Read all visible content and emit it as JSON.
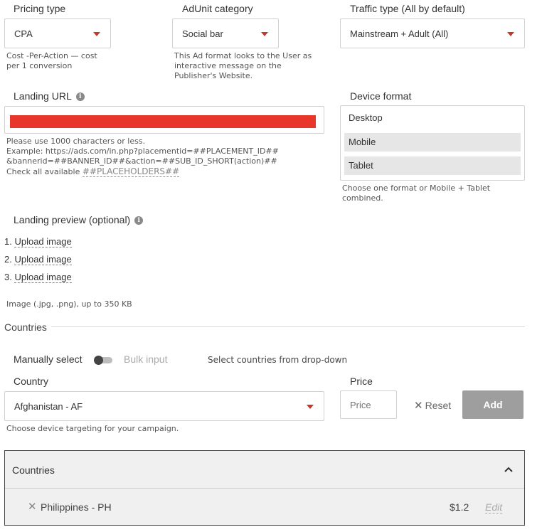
{
  "pricing": {
    "label": "Pricing type",
    "value": "CPA",
    "hint": "Cost -Per-Action — cost per 1 conversion"
  },
  "adunit": {
    "label": "AdUnit category",
    "value": "Social bar",
    "hint": "This Ad format looks to the User as interactive message on the Publisher's Website."
  },
  "traffic": {
    "label": "Traffic type (All by default)",
    "value": "Mainstream + Adult (All)"
  },
  "landing": {
    "label": "Landing URL",
    "hint_line1": "Please use 1000 characters or less.",
    "hint_line2": "Example: https://ads.com/in.php?placementid=##PLACEMENT_ID##",
    "hint_line3": "&bannerid=##BANNER_ID##&action=##SUB_ID_SHORT(action)##",
    "hint_line4_prefix": "Check all available ",
    "hint_line4_link": "##PLACEHOLDERS##"
  },
  "device": {
    "label": "Device format",
    "options": [
      "Desktop",
      "Mobile",
      "Tablet"
    ],
    "hint": "Choose one format or Mobile + Tablet combined."
  },
  "preview": {
    "label": "Landing preview (optional)",
    "items": [
      {
        "num": "1.",
        "label": "Upload image"
      },
      {
        "num": "2.",
        "label": "Upload image"
      },
      {
        "num": "3.",
        "label": "Upload image"
      }
    ],
    "hint": "Image (.jpg, .png), up to 350 KB"
  },
  "countries_section": {
    "title": "Countries",
    "manual_label": "Manually select",
    "bulk_label": "Bulk input",
    "select_hint": "Select countries from drop-down",
    "country_label": "Country",
    "country_value": "Afghanistan - AF",
    "price_label": "Price",
    "price_placeholder": "Price",
    "reset_label": "Reset",
    "add_label": "Add",
    "device_hint": "Choose device targeting for your campaign."
  },
  "countries_table": {
    "header": "Countries",
    "rows": [
      {
        "name": "Philippines - PH",
        "price": "$1.2",
        "edit": "Edit"
      }
    ]
  },
  "colors": {
    "accent": "#c0392b",
    "redacted": "#e8372a",
    "add_button": "#9e9e9e"
  }
}
